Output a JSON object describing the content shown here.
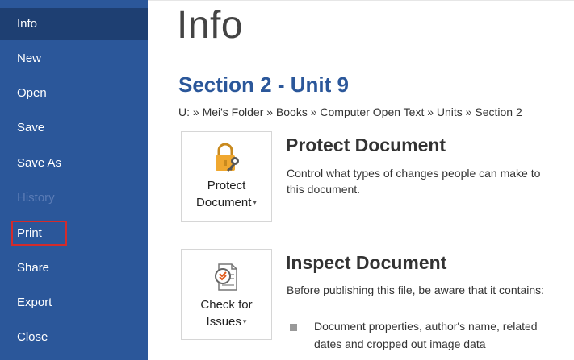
{
  "sidebar": {
    "items": [
      {
        "label": "Info",
        "state": "active"
      },
      {
        "label": "New",
        "state": "normal"
      },
      {
        "label": "Open",
        "state": "normal"
      },
      {
        "label": "Save",
        "state": "normal"
      },
      {
        "label": "Save As",
        "state": "normal"
      },
      {
        "label": "History",
        "state": "disabled"
      },
      {
        "label": "Print",
        "state": "highlighted"
      },
      {
        "label": "Share",
        "state": "normal"
      },
      {
        "label": "Export",
        "state": "normal"
      },
      {
        "label": "Close",
        "state": "normal"
      }
    ]
  },
  "main": {
    "title": "Info",
    "section_title": "Section 2 - Unit 9",
    "breadcrumb": "U: » Mei's Folder » Books » Computer Open Text » Units » Section 2",
    "protect": {
      "button_line1": "Protect",
      "button_line2": "Document",
      "heading": "Protect Document",
      "description": "Control what types of changes people can make to this document.",
      "icon": "lock-key-icon"
    },
    "inspect": {
      "button_line1": "Check for",
      "button_line2": "Issues",
      "heading": "Inspect Document",
      "description": "Before publishing this file, be aware that it contains:",
      "bullet": "Document properties, author's name, related dates and cropped out image data",
      "icon": "inspect-document-icon"
    }
  },
  "colors": {
    "sidebar_bg": "#2b579a",
    "sidebar_active": "#1e3f72",
    "accent": "#2b579a",
    "highlight_border": "#d42b2b"
  }
}
